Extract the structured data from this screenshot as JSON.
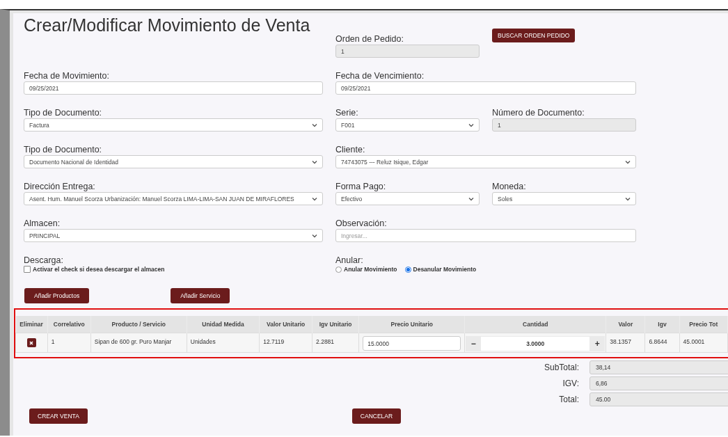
{
  "title": "Crear/Modificar Movimiento de Venta",
  "form_rows": [
    [
      {
        "kind": "input",
        "label": "Orden de Pedido:",
        "value": "1",
        "disabled": true
      },
      {
        "kind": "button",
        "label": "BUSCAR ORDEN PEDIDO"
      }
    ],
    [
      {
        "kind": "input",
        "label": "Fecha de Movimiento:",
        "value": "09/25/2021",
        "disabled": false
      },
      {
        "kind": "input",
        "label": "Fecha de Vencimiento:",
        "value": "09/25/2021",
        "disabled": false
      }
    ],
    [
      {
        "kind": "select",
        "label": "Tipo de Documento:",
        "value": "Factura"
      },
      {
        "kind": "select",
        "label": "Serie:",
        "value": "F001"
      },
      {
        "kind": "input",
        "label": "Número de Documento:",
        "value": "1",
        "disabled": true
      }
    ],
    [
      {
        "kind": "select",
        "label": "Tipo de Documento:",
        "value": "Documento Nacional de Identidad"
      },
      {
        "kind": "select",
        "label": "Cliente:",
        "value": "74743075 --- Reluz Isique, Edgar"
      }
    ],
    [
      {
        "kind": "select",
        "label": "Dirección Entrega:",
        "value": "Asent. Hum. Manuel Scorza Urbanización: Manuel Scorza LIMA-LIMA-SAN JUAN DE MIRAFLORES"
      },
      {
        "kind": "select",
        "label": "Forma Pago:",
        "value": "Efectivo"
      },
      {
        "kind": "select",
        "label": "Moneda:",
        "value": "Soles"
      }
    ],
    [
      {
        "kind": "select",
        "label": "Almacen:",
        "value": "PRINCIPAL"
      },
      {
        "kind": "input",
        "label": "Observación:",
        "placeholder": "Ingresar...",
        "disabled": false
      }
    ],
    [
      {
        "kind": "checkbox",
        "label": "Descarga:",
        "option": "Activar el check si desea descargar el almacen",
        "checked": false
      },
      {
        "kind": "radios",
        "label": "Anular:",
        "options": [
          {
            "label": "Anular Movimiento",
            "selected": false
          },
          {
            "label": "Desanular Movimiento",
            "selected": true
          }
        ]
      }
    ]
  ],
  "add_buttons": [
    "Añadir Productos",
    "Añadir Servicio"
  ],
  "table": {
    "columns": [
      "Eliminar",
      "Correlativo",
      "Producto / Servicio",
      "Unidad Medida",
      "Valor Unitario",
      "Igv Unitario",
      "Precio Unitario",
      "Cantidad",
      "Valor",
      "Igv",
      "Precio Tot"
    ],
    "rows": [
      {
        "correlativo": "1",
        "producto": "Sipan de 600 gr. Puro Manjar",
        "unidad": "Unidades",
        "valor_unitario": "12.7119",
        "igv_unitario": "2.2881",
        "precio_unitario": "15.0000",
        "cantidad": "3.0000",
        "decrement": "−",
        "increment": "+",
        "valor": "38.1357",
        "igv": "6.8644",
        "precio_total": "45.0001"
      }
    ]
  },
  "totals": [
    {
      "label": "SubTotal:",
      "value": "38,14"
    },
    {
      "label": "IGV:",
      "value": "6,86"
    },
    {
      "label": "Total:",
      "value": "45.00"
    }
  ],
  "footer_buttons": [
    "CREAR VENTA",
    "CANCELAR"
  ]
}
